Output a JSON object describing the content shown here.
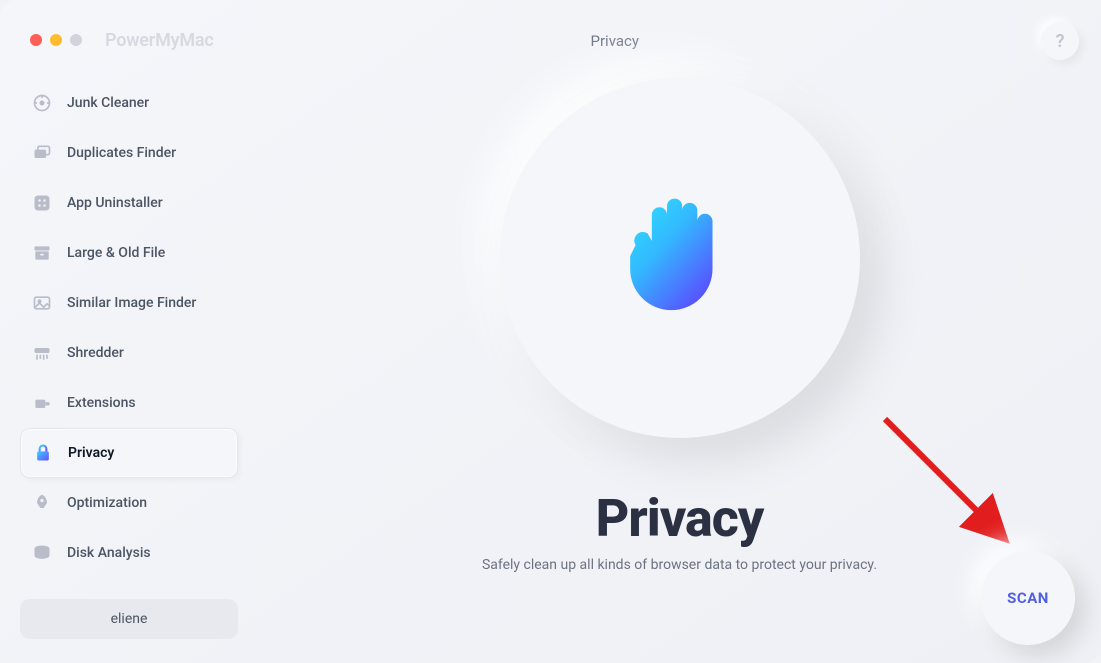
{
  "app": {
    "name": "PowerMyMac"
  },
  "header": {
    "title": "Privacy",
    "help_glyph": "?"
  },
  "sidebar": {
    "items": [
      {
        "label": "Junk Cleaner",
        "active": false
      },
      {
        "label": "Duplicates Finder",
        "active": false
      },
      {
        "label": "App Uninstaller",
        "active": false
      },
      {
        "label": "Large & Old File",
        "active": false
      },
      {
        "label": "Similar Image Finder",
        "active": false
      },
      {
        "label": "Shredder",
        "active": false
      },
      {
        "label": "Extensions",
        "active": false
      },
      {
        "label": "Privacy",
        "active": true
      },
      {
        "label": "Optimization",
        "active": false
      },
      {
        "label": "Disk Analysis",
        "active": false
      }
    ]
  },
  "user": {
    "name": "eliene"
  },
  "feature": {
    "title": "Privacy",
    "subtitle": "Safely clean up all kinds of browser data to protect your privacy."
  },
  "actions": {
    "scan_label": "SCAN"
  },
  "colors": {
    "accent": "#4f5fe4",
    "arrow": "#e11d1d"
  }
}
